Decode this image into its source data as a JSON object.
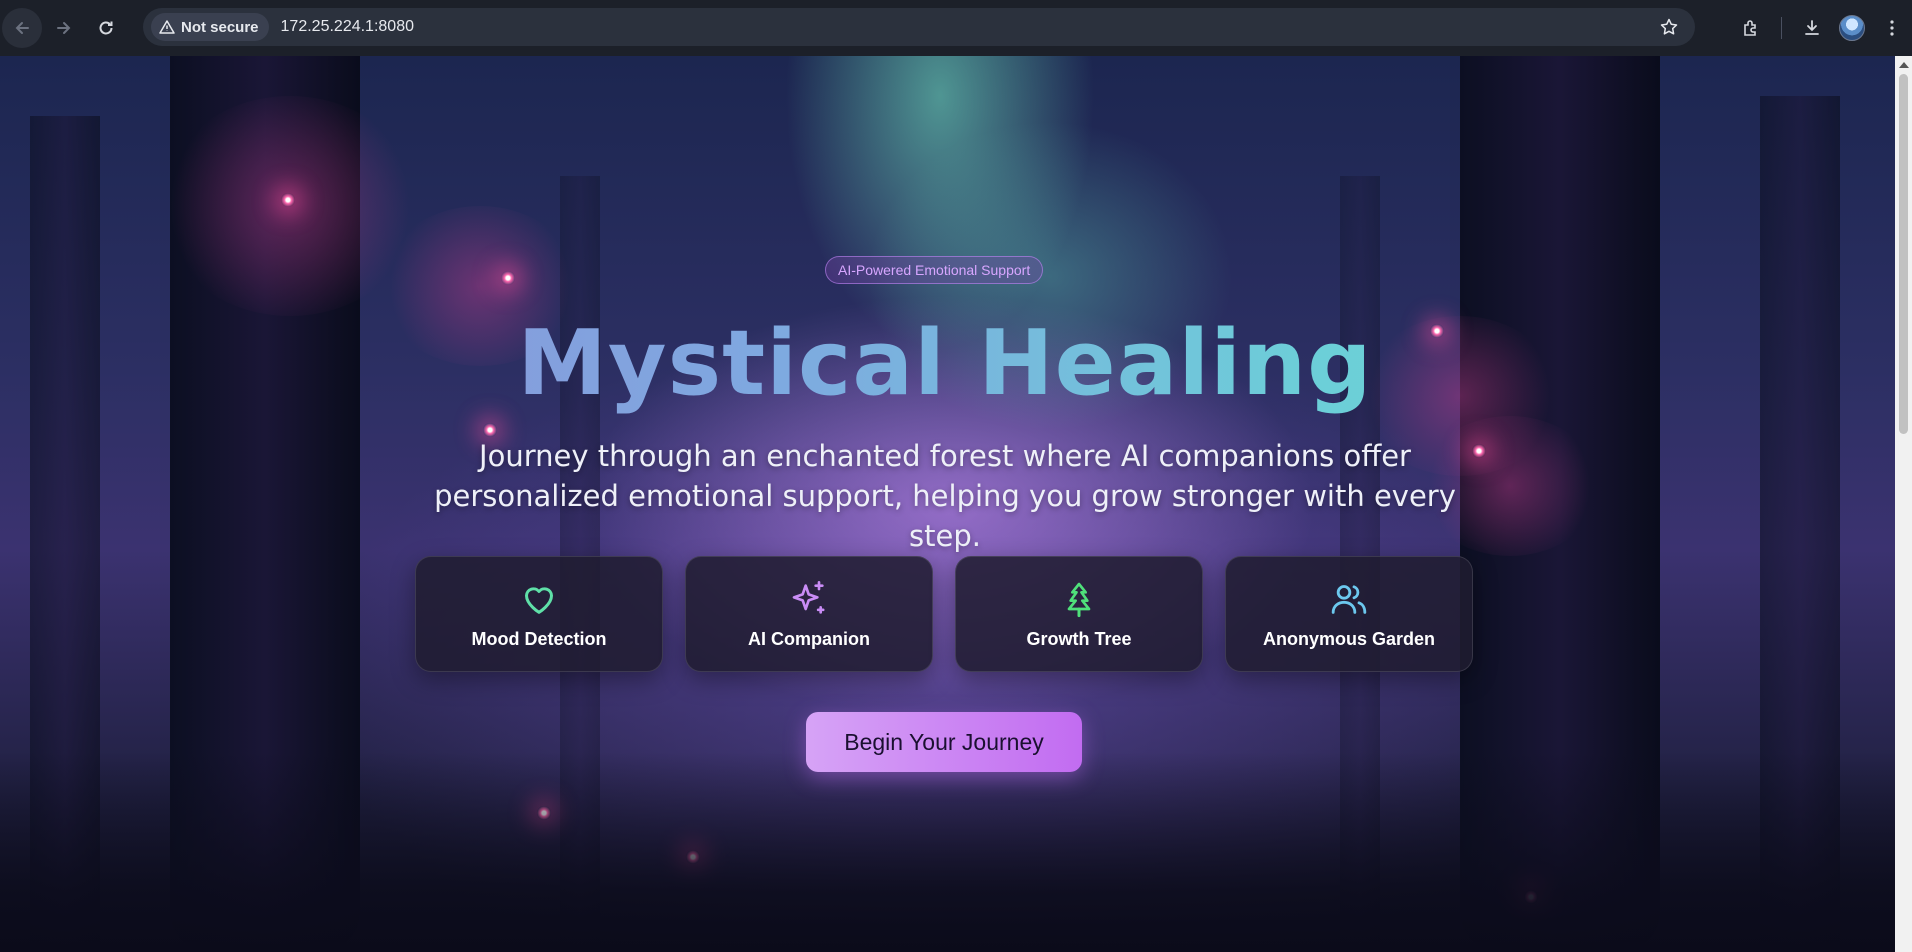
{
  "browser": {
    "security_label": "Not secure",
    "url": "172.25.224.1:8080",
    "icons": {
      "back": "arrow-left-icon",
      "forward": "arrow-right-icon",
      "reload": "reload-icon",
      "security": "warning-triangle-icon",
      "bookmark": "star-icon",
      "extensions": "puzzle-icon",
      "downloads": "download-icon",
      "profile": "avatar",
      "menu": "kebab-menu-icon"
    }
  },
  "hero": {
    "badge": "AI-Powered Emotional Support",
    "title": "Mystical Healing",
    "subtitle": "Journey through an enchanted forest where AI companions offer personalized emotional support, helping you grow stronger with every step.",
    "cta_label": "Begin Your Journey"
  },
  "features": [
    {
      "label": "Mood Detection",
      "icon": "heart-icon",
      "color": "#5fe0a8"
    },
    {
      "label": "AI Companion",
      "icon": "sparkles-icon",
      "color": "#c98cf5"
    },
    {
      "label": "Growth Tree",
      "icon": "tree-icon",
      "color": "#4fe07a"
    },
    {
      "label": "Anonymous Garden",
      "icon": "users-icon",
      "color": "#6cc8ee"
    }
  ],
  "colors": {
    "accent_start": "#d6a3f6",
    "accent_end": "#c26cf1",
    "title_gradient_start": "#8e8bd6",
    "title_gradient_end": "#66d4c6"
  }
}
